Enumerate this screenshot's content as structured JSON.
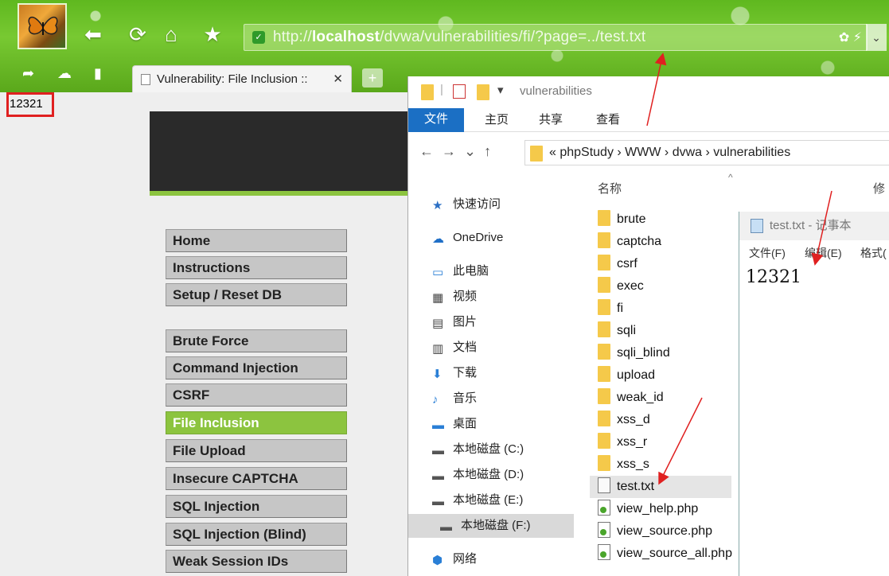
{
  "browser": {
    "url_prefix": "http://",
    "url_host": "localhost",
    "url_path": "/dvwa/vulnerabilities/fi/?page=../test.txt",
    "tab_title": "Vulnerability: File Inclusion ::",
    "tab_close": "✕",
    "new_tab": "+"
  },
  "page": {
    "output_text": "12321",
    "menu": [
      {
        "label": "Home"
      },
      {
        "label": "Instructions"
      },
      {
        "label": "Setup / Reset DB"
      },
      {
        "label": "Brute Force"
      },
      {
        "label": "Command Injection"
      },
      {
        "label": "CSRF"
      },
      {
        "label": "File Inclusion",
        "active": true
      },
      {
        "label": "File Upload"
      },
      {
        "label": "Insecure CAPTCHA"
      },
      {
        "label": "SQL Injection"
      },
      {
        "label": "SQL Injection (Blind)"
      },
      {
        "label": "Weak Session IDs"
      }
    ],
    "accent_color": "#8cc43f"
  },
  "explorer": {
    "window_title": "vulnerabilities",
    "ribbon": {
      "file": "文件",
      "home": "主页",
      "share": "共享",
      "view": "查看"
    },
    "breadcrumb": "« phpStudy › WWW › dvwa › vulnerabilities",
    "column_name": "名称",
    "column_modified": "修",
    "sidebar": [
      {
        "label": "快速访问",
        "icon": "star-icon"
      },
      {
        "label": "OneDrive",
        "icon": "cloud-icon"
      },
      {
        "label": "此电脑",
        "icon": "computer-icon"
      },
      {
        "label": "视频",
        "icon": "video-icon"
      },
      {
        "label": "图片",
        "icon": "picture-icon"
      },
      {
        "label": "文档",
        "icon": "document-icon"
      },
      {
        "label": "下载",
        "icon": "download-icon"
      },
      {
        "label": "音乐",
        "icon": "music-icon"
      },
      {
        "label": "桌面",
        "icon": "desktop-icon"
      },
      {
        "label": "本地磁盘 (C:)",
        "icon": "drive-icon"
      },
      {
        "label": "本地磁盘 (D:)",
        "icon": "drive-icon"
      },
      {
        "label": "本地磁盘 (E:)",
        "icon": "drive-icon"
      },
      {
        "label": "本地磁盘 (F:)",
        "icon": "drive-icon",
        "selected": true
      },
      {
        "label": "网络",
        "icon": "network-icon"
      }
    ],
    "files": [
      {
        "name": "brute",
        "type": "folder"
      },
      {
        "name": "captcha",
        "type": "folder"
      },
      {
        "name": "csrf",
        "type": "folder"
      },
      {
        "name": "exec",
        "type": "folder"
      },
      {
        "name": "fi",
        "type": "folder"
      },
      {
        "name": "sqli",
        "type": "folder"
      },
      {
        "name": "sqli_blind",
        "type": "folder"
      },
      {
        "name": "upload",
        "type": "folder"
      },
      {
        "name": "weak_id",
        "type": "folder"
      },
      {
        "name": "xss_d",
        "type": "folder"
      },
      {
        "name": "xss_r",
        "type": "folder"
      },
      {
        "name": "xss_s",
        "type": "folder"
      },
      {
        "name": "test.txt",
        "type": "txt",
        "selected": true
      },
      {
        "name": "view_help.php",
        "type": "php"
      },
      {
        "name": "view_source.php",
        "type": "php"
      },
      {
        "name": "view_source_all.php",
        "type": "php"
      }
    ]
  },
  "notepad": {
    "title": "test.txt - 记事本",
    "menu_file": "文件(F)",
    "menu_edit": "编辑(E)",
    "menu_format": "格式(",
    "content": "12321"
  }
}
